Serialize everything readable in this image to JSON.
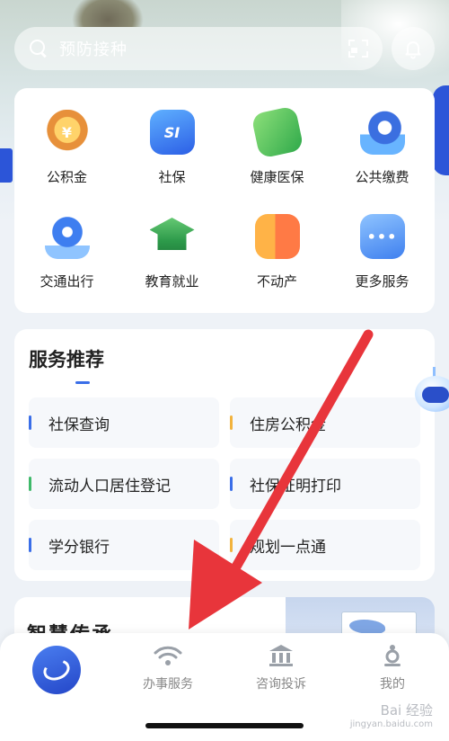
{
  "search": {
    "placeholder": "预防接种"
  },
  "services_grid": [
    {
      "label": "公积金",
      "icon": "provident-fund-icon",
      "glyph": "¥"
    },
    {
      "label": "社保",
      "icon": "social-security-icon",
      "glyph": "SI"
    },
    {
      "label": "健康医保",
      "icon": "health-insurance-icon",
      "glyph": ""
    },
    {
      "label": "公共缴费",
      "icon": "public-payment-icon",
      "glyph": ""
    },
    {
      "label": "交通出行",
      "icon": "traffic-icon",
      "glyph": ""
    },
    {
      "label": "教育就业",
      "icon": "education-icon",
      "glyph": ""
    },
    {
      "label": "不动产",
      "icon": "real-estate-icon",
      "glyph": ""
    },
    {
      "label": "更多服务",
      "icon": "more-services-icon",
      "glyph": "•••"
    }
  ],
  "recommend": {
    "title": "服务推荐",
    "items": [
      {
        "label": "社保查询",
        "color": "#3a6ee8"
      },
      {
        "label": "住房公积金",
        "color": "#f2b33d"
      },
      {
        "label": "流动人口居住登记",
        "color": "#3fb96a"
      },
      {
        "label": "社保证明打印",
        "color": "#3a6ee8"
      },
      {
        "label": "学分银行",
        "color": "#3a6ee8"
      },
      {
        "label": "规划一点通",
        "color": "#f2b33d"
      }
    ]
  },
  "wisdom": {
    "title": "智慧传承"
  },
  "tabbar": {
    "items": [
      {
        "label": "办事服务",
        "icon": "wifi-icon"
      },
      {
        "label": "咨询投诉",
        "icon": "building-icon"
      },
      {
        "label": "我的",
        "icon": "user-icon"
      }
    ]
  },
  "watermark": {
    "line1": "Bai 经验",
    "line2": "jingyan.baidu.com"
  },
  "colors": {
    "accent": "#2c55d8",
    "arrow": "#e8353b"
  }
}
